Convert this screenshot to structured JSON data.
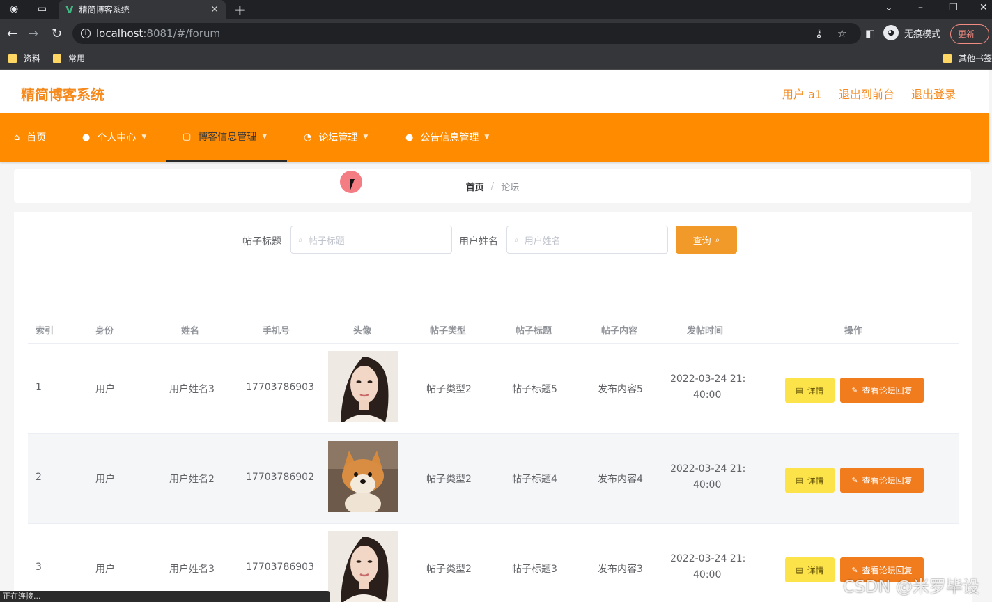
{
  "browser": {
    "tab_title": "精简博客系统",
    "url_host": "localhost",
    "url_rest": ":8081/#/forum",
    "incognito_label": "无痕模式",
    "update_label": "更新",
    "bookmarks": [
      "资料",
      "常用"
    ],
    "other_bookmarks": "其他书签",
    "status_text": "正在连接..."
  },
  "header": {
    "title": "精简博客系统",
    "user_label": "用户 a1",
    "back_front": "退出到前台",
    "logout": "退出登录"
  },
  "menu": {
    "items": [
      {
        "label": "首页",
        "icon": "home-icon"
      },
      {
        "label": "个人中心",
        "icon": "user-icon"
      },
      {
        "label": "博客信息管理",
        "icon": "doc-icon"
      },
      {
        "label": "论坛管理",
        "icon": "forum-icon"
      },
      {
        "label": "公告信息管理",
        "icon": "user-icon"
      }
    ]
  },
  "breadcrumb": {
    "home": "首页",
    "separator": "/",
    "current": "论坛"
  },
  "search": {
    "title_label": "帖子标题",
    "title_placeholder": "帖子标题",
    "name_label": "用户姓名",
    "name_placeholder": "用户姓名",
    "query_label": "查询"
  },
  "table": {
    "headers": [
      "索引",
      "身份",
      "姓名",
      "手机号",
      "头像",
      "帖子类型",
      "帖子标题",
      "帖子内容",
      "发帖时间",
      "操作"
    ],
    "rows": [
      {
        "index": "1",
        "role": "用户",
        "name": "用户姓名3",
        "phone": "17703786903",
        "avatar": "woman-portrait",
        "type": "帖子类型2",
        "title": "帖子标题5",
        "content": "发布内容5",
        "time_line1": "2022-03-24 21:",
        "time_line2": "40:00"
      },
      {
        "index": "2",
        "role": "用户",
        "name": "用户姓名2",
        "phone": "17703786902",
        "avatar": "shiba-dog",
        "type": "帖子类型2",
        "title": "帖子标题4",
        "content": "发布内容4",
        "time_line1": "2022-03-24 21:",
        "time_line2": "40:00"
      },
      {
        "index": "3",
        "role": "用户",
        "name": "用户姓名3",
        "phone": "17703786903",
        "avatar": "woman-portrait",
        "type": "帖子类型2",
        "title": "帖子标题3",
        "content": "发布内容3",
        "time_line1": "2022-03-24 21:",
        "time_line2": "40:00"
      }
    ],
    "detail_label": "详情",
    "reply_label": "查看论坛回复"
  },
  "watermark": "CSDN @米罗毕设",
  "colors": {
    "accent": "#ff8c00",
    "title": "#f5891c",
    "detail_btn": "#fde34a",
    "reply_btn": "#f07c1e"
  }
}
